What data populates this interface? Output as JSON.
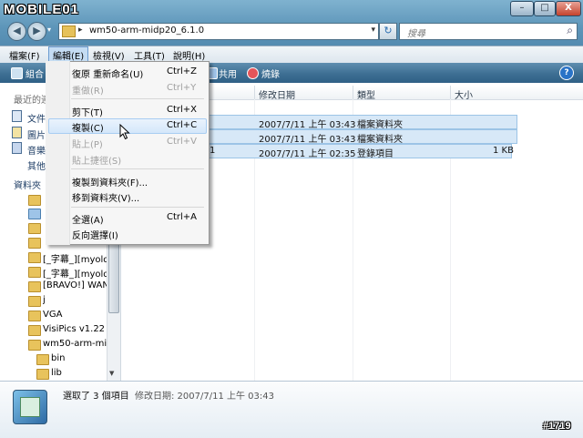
{
  "watermark": "MOBILE01",
  "window_buttons": {
    "min": "–",
    "max": "□",
    "close": "X"
  },
  "address": {
    "path": "wm50-arm-midp20_6.1.0",
    "arrow": "▸"
  },
  "search": {
    "placeholder": "搜尋"
  },
  "menubar": [
    "檔案(F)",
    "編輯(E)",
    "檢視(V)",
    "工具(T)",
    "說明(H)"
  ],
  "toolbar": {
    "organize": "組合",
    "share": "共用",
    "burn": "燒錄"
  },
  "leftpane": {
    "recent_header": "最近的連",
    "links": [
      "文件",
      "圖片",
      "音樂",
      "其他"
    ],
    "folders_header": "資料夾",
    "tree": [
      "[_字幕_][myold",
      "[_字幕_][myold",
      "[BRAVO!] WANT",
      "j",
      "VGA",
      "VisiPics v1.22",
      "wm50-arm-mid",
      "bin",
      "lib"
    ]
  },
  "columns": {
    "date": "修改日期",
    "type": "類型",
    "size": "大小"
  },
  "rows": [
    {
      "date": "2007/7/11 上午 03:43",
      "type": "檔案資料夾",
      "size": ""
    },
    {
      "date": "2007/7/11 上午 03:43",
      "type": "檔案資料夾",
      "size": ""
    },
    {
      "name_tail": "1",
      "date": "2007/7/11 上午 02:35",
      "type": "登錄項目",
      "size": "1 KB"
    }
  ],
  "edit_menu": {
    "undo": {
      "label": "復原 重新命名(U)",
      "shortcut": "Ctrl+Z"
    },
    "redo": {
      "label": "重做(R)",
      "shortcut": "Ctrl+Y"
    },
    "cut": {
      "label": "剪下(T)",
      "shortcut": "Ctrl+X"
    },
    "copy": {
      "label": "複製(C)",
      "shortcut": "Ctrl+C"
    },
    "paste": {
      "label": "貼上(P)",
      "shortcut": "Ctrl+V"
    },
    "paste_shortcut": {
      "label": "貼上捷徑(S)"
    },
    "copy_to": {
      "label": "複製到資料夾(F)..."
    },
    "move_to": {
      "label": "移到資料夾(V)..."
    },
    "select_all": {
      "label": "全選(A)",
      "shortcut": "Ctrl+A"
    },
    "invert": {
      "label": "反向選擇(I)"
    }
  },
  "details": {
    "selected": "選取了 3 個項目",
    "date_label": "修改日期: 2007/7/11 上午 03:43"
  },
  "badge": "#1719",
  "colors": {
    "selection": "#d7e8f7",
    "toolbar": "#3e6f93",
    "accent": "#2a73c7"
  }
}
